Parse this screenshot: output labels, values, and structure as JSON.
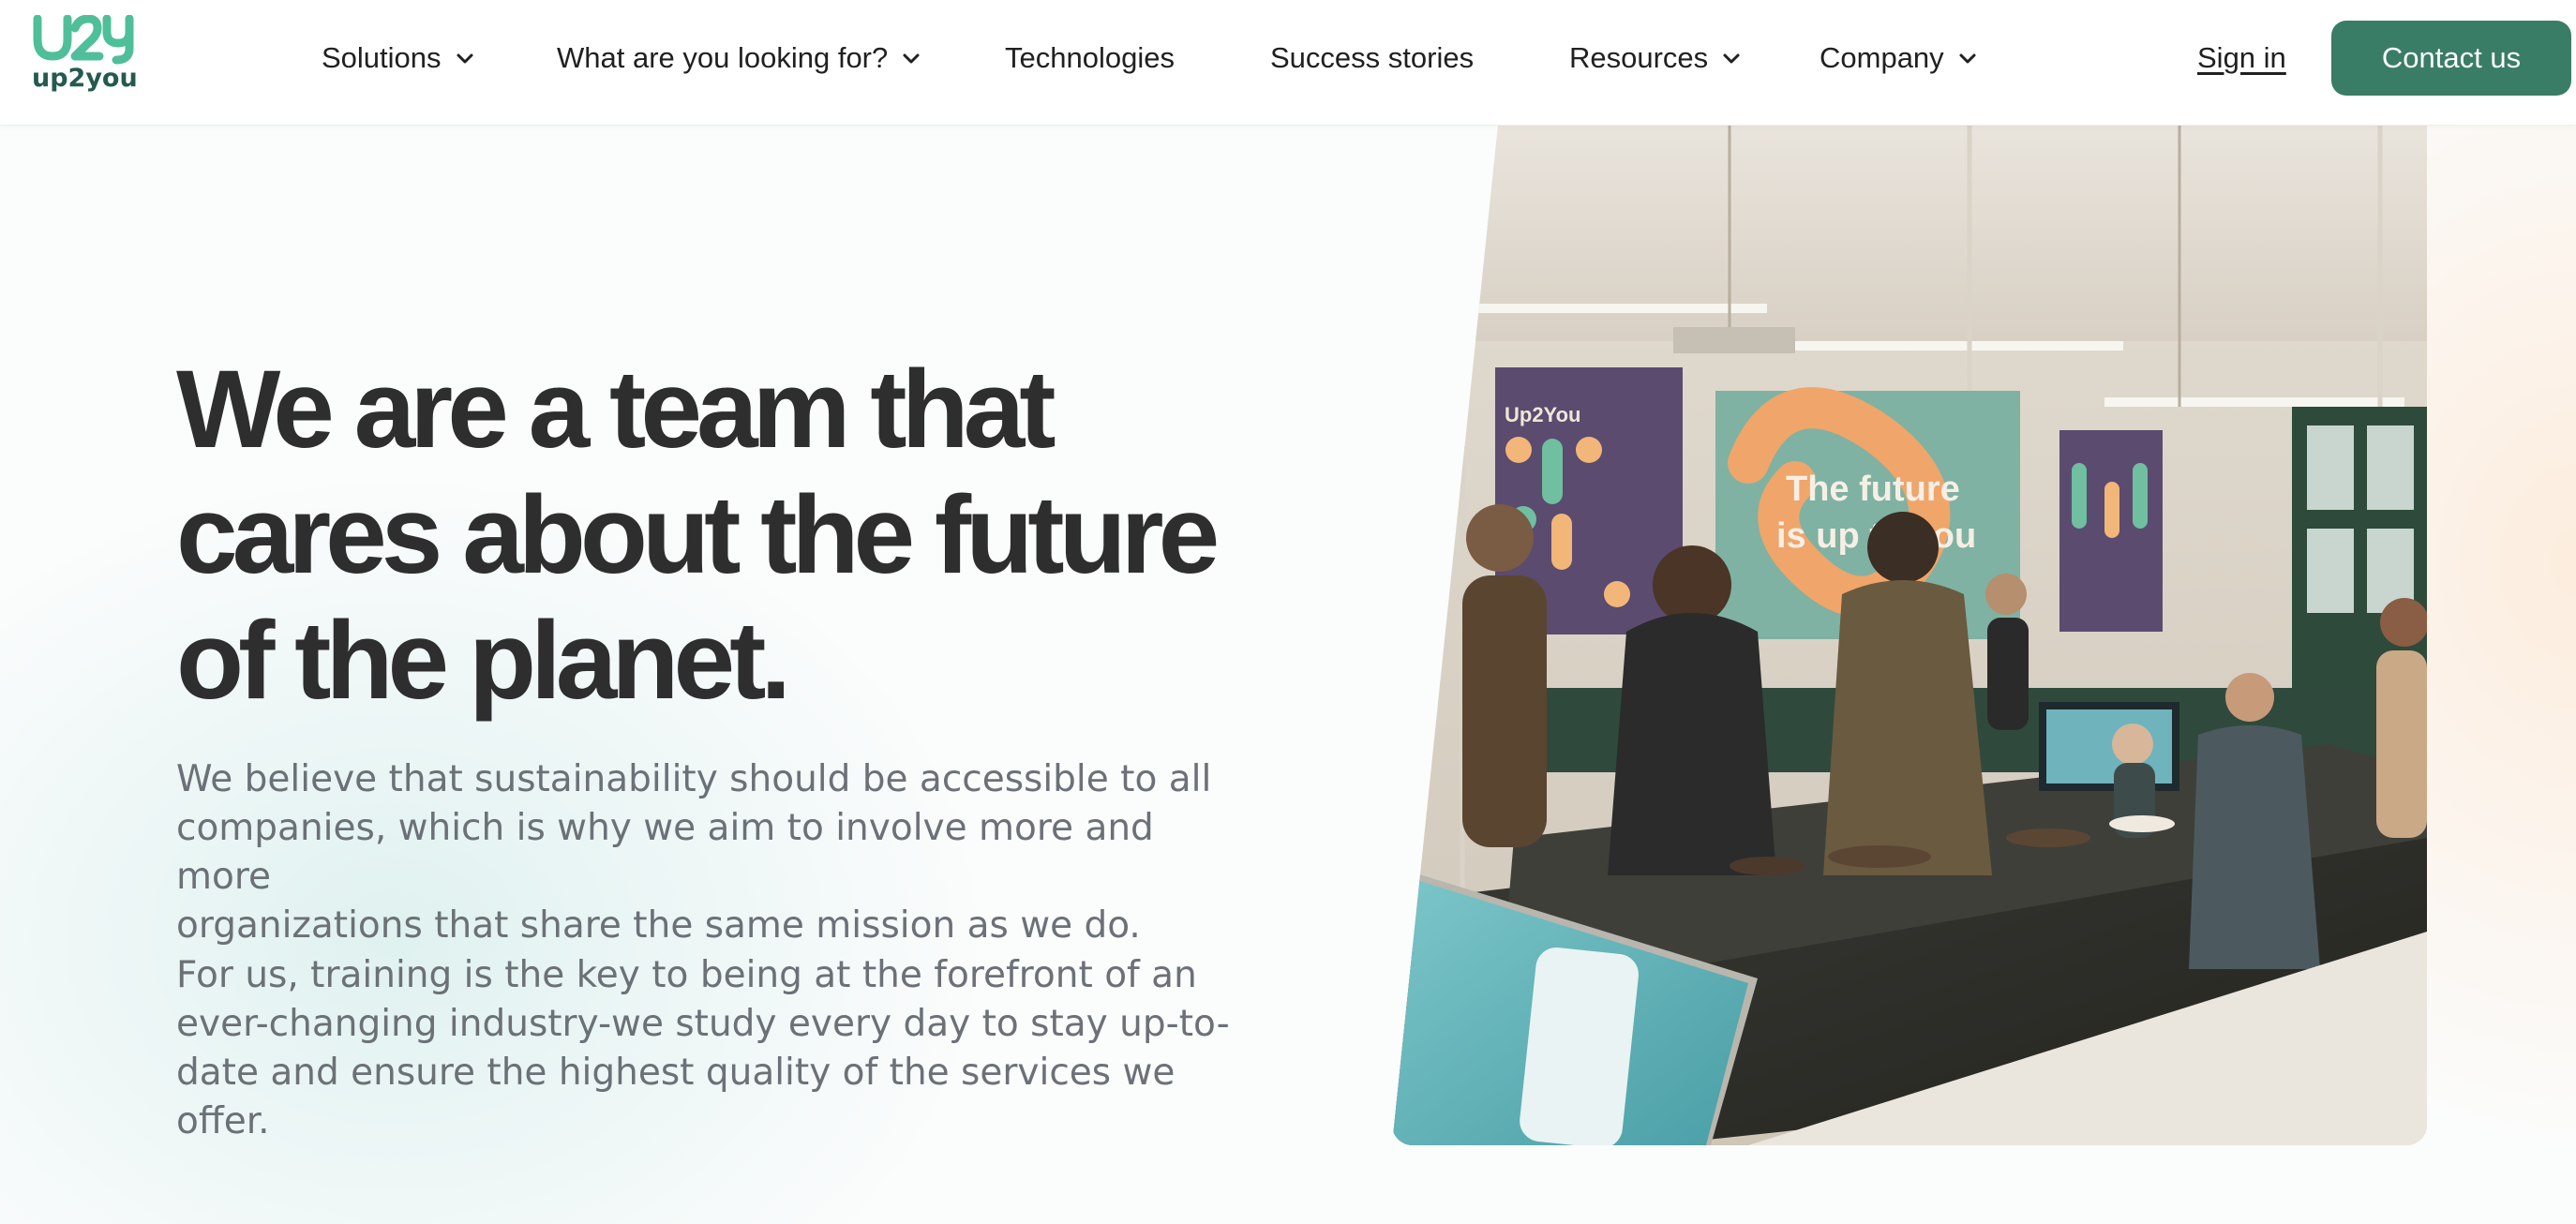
{
  "brand": {
    "logo_mark": "U2Y",
    "logo_text": "up2you",
    "logo_color": "#4fbf9a",
    "dark_color": "#245a4f"
  },
  "nav": {
    "items": [
      {
        "label": "Solutions",
        "has_dropdown": true
      },
      {
        "label": "What are you looking for?",
        "has_dropdown": true
      },
      {
        "label": "Technologies",
        "has_dropdown": false
      },
      {
        "label": "Success stories",
        "has_dropdown": false
      },
      {
        "label": "Resources",
        "has_dropdown": true
      },
      {
        "label": "Company",
        "has_dropdown": true
      }
    ],
    "signin_label": "Sign in",
    "contact_label": "Contact us",
    "accent_color": "#3a7d67"
  },
  "hero": {
    "headline_lines": [
      "We are a team that",
      "cares about the future",
      "of the planet."
    ],
    "paragraph_1_lines": [
      "We believe that sustainability should be accessible to all",
      "companies, which is why we aim to involve more and more",
      "organizations that share the same mission as we do."
    ],
    "paragraph_2_lines": [
      "For us, training is the key to being at the forefront of an",
      "ever-changing industry-we study every day to stay up-to-",
      "date and ensure the highest quality of the services we",
      "offer."
    ]
  },
  "photo": {
    "poster_brand": "Up2You",
    "poster_slogan_lines": [
      "The future",
      "is up to you"
    ]
  }
}
